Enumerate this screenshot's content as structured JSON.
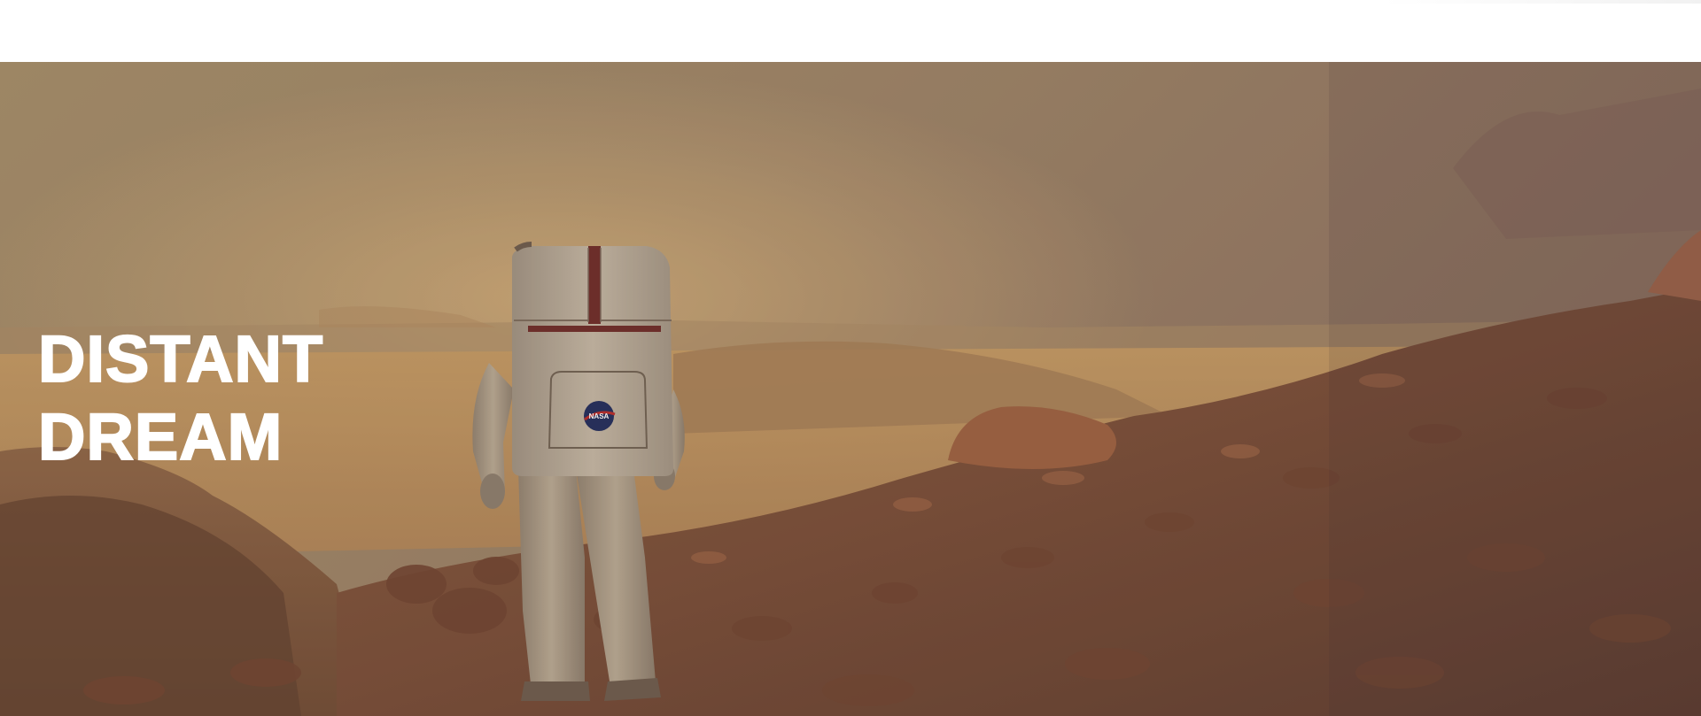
{
  "hero": {
    "title_line_1": "DISTANT",
    "title_line_2": "DREAM",
    "background_scene": "mars-astronaut-image",
    "patch_text": "NASA"
  },
  "colors": {
    "sky": "#a08a6c",
    "haze": "#c7a06a",
    "ground_dark": "#5a3a2c",
    "ground_mid": "#8a5a3e",
    "suit": "#b7a894",
    "title": "#ffffff"
  }
}
